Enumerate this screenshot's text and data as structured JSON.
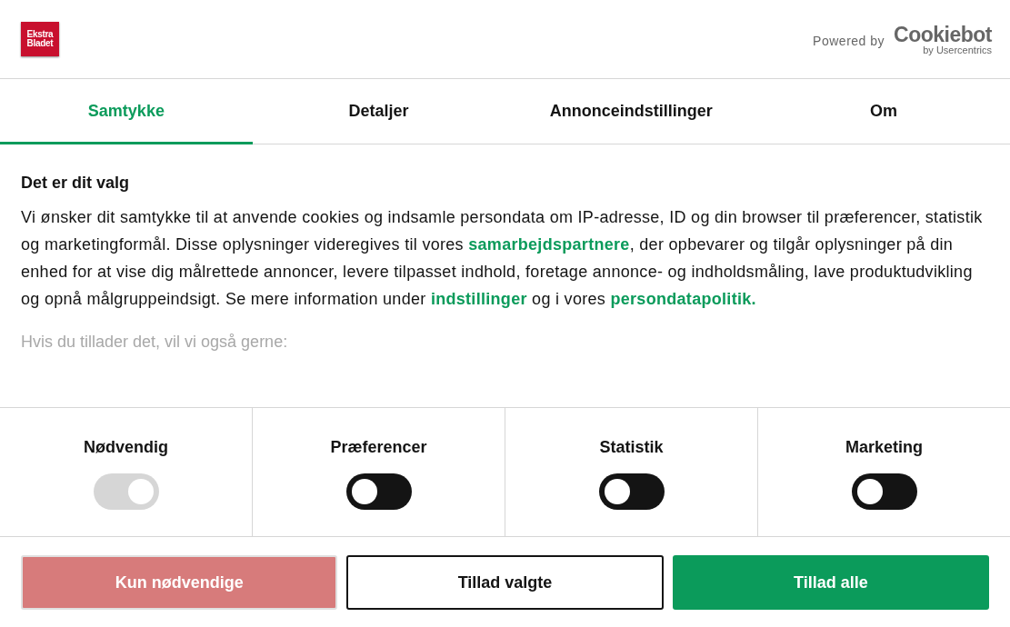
{
  "header": {
    "logo": {
      "line1": "Ekstra",
      "line2": "Bladet"
    },
    "powered_by": "Powered by",
    "brand": "Cookiebot",
    "brand_sub": "by Usercentrics"
  },
  "tabs": [
    {
      "label": "Samtykke",
      "selected": true
    },
    {
      "label": "Detaljer",
      "selected": false
    },
    {
      "label": "Annonceindstillinger",
      "selected": false
    },
    {
      "label": "Om",
      "selected": false
    }
  ],
  "content": {
    "heading": "Det er dit valg",
    "paragraph": [
      {
        "kind": "text",
        "text": "Vi ønsker dit samtykke til at anvende cookies og indsamle persondata om IP-adresse, ID og din browser til præferencer, statistik og marketingformål. Disse oplysninger videregives til vores "
      },
      {
        "kind": "link",
        "text": "samarbejdspartnere"
      },
      {
        "kind": "text",
        "text": ", der opbevarer og tilgår oplysninger på din enhed for at vise dig målrettede annoncer, levere tilpasset indhold, foretage annonce- og indholdsmåling, lave produktudvikling og opnå målgruppeindsigt. Se mere information under "
      },
      {
        "kind": "link",
        "text": "indstillinger"
      },
      {
        "kind": "text",
        "text": " og i vores "
      },
      {
        "kind": "link",
        "text": "persondatapolitik."
      }
    ],
    "faded_line": "Hvis du tillader det, vil vi også gerne:"
  },
  "categories": [
    {
      "label": "Nødvendig",
      "checked": true,
      "disabled": true
    },
    {
      "label": "Præferencer",
      "checked": false,
      "disabled": false
    },
    {
      "label": "Statistik",
      "checked": false,
      "disabled": false
    },
    {
      "label": "Marketing",
      "checked": false,
      "disabled": false
    }
  ],
  "buttons": [
    {
      "kind": "decline",
      "label": "Kun nødvendige"
    },
    {
      "kind": "selection",
      "label": "Tillad valgte"
    },
    {
      "kind": "accept",
      "label": "Tillad alle"
    }
  ]
}
